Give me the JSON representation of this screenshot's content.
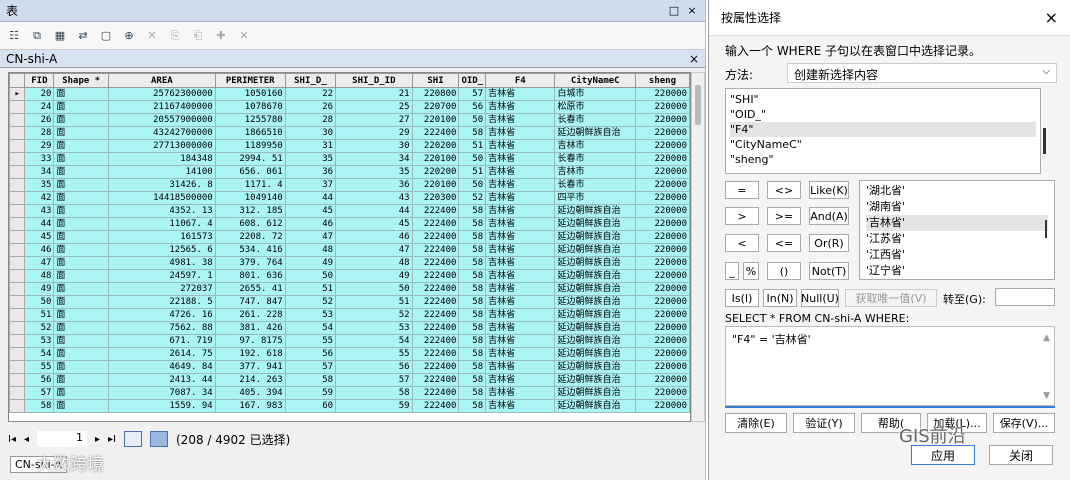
{
  "table_window": {
    "title": "表",
    "title_controls": [
      "□",
      "×"
    ],
    "toolbar_icons": [
      "table-options-icon",
      "related-tables-icon",
      "select-by-attributes-icon",
      "switch-selection-icon",
      "clear-selection-icon",
      "zoom-to-selected-icon",
      "delete-selected-icon",
      "copy-icon",
      "paste-icon",
      "add-field-icon",
      "close-toolbar-icon"
    ],
    "tab_name": "CN-shi-A",
    "tab_close": "×",
    "columns": [
      "FID",
      "Shape *",
      "AREA",
      "PERIMETER",
      "SHI_D_",
      "SHI_D_ID",
      "SHI",
      "OID_",
      "F4",
      "CityNameC",
      "sheng"
    ],
    "rows": [
      [
        "20",
        "面",
        "25762300000",
        "1050160",
        "22",
        "21",
        "220800",
        "57",
        "吉林省",
        "白城市",
        "220000"
      ],
      [
        "24",
        "面",
        "21167400000",
        "1078670",
        "26",
        "25",
        "220700",
        "56",
        "吉林省",
        "松原市",
        "220000"
      ],
      [
        "26",
        "面",
        "20557900000",
        "1255780",
        "28",
        "27",
        "220100",
        "50",
        "吉林省",
        "长春市",
        "220000"
      ],
      [
        "28",
        "面",
        "43242700000",
        "1866510",
        "30",
        "29",
        "222400",
        "58",
        "吉林省",
        "延边朝鲜族自治",
        "220000"
      ],
      [
        "29",
        "面",
        "27713000000",
        "1189950",
        "31",
        "30",
        "220200",
        "51",
        "吉林省",
        "吉林市",
        "220000"
      ],
      [
        "33",
        "面",
        "184348",
        "2994. 51",
        "35",
        "34",
        "220100",
        "50",
        "吉林省",
        "长春市",
        "220000"
      ],
      [
        "34",
        "面",
        "14100",
        "656. 061",
        "36",
        "35",
        "220200",
        "51",
        "吉林省",
        "吉林市",
        "220000"
      ],
      [
        "35",
        "面",
        "31426. 8",
        "1171. 4",
        "37",
        "36",
        "220100",
        "50",
        "吉林省",
        "长春市",
        "220000"
      ],
      [
        "42",
        "面",
        "14418500000",
        "1049140",
        "44",
        "43",
        "220300",
        "52",
        "吉林省",
        "四平市",
        "220000"
      ],
      [
        "43",
        "面",
        "4352. 13",
        "312. 185",
        "45",
        "44",
        "222400",
        "58",
        "吉林省",
        "延边朝鲜族自治",
        "220000"
      ],
      [
        "44",
        "面",
        "11067. 4",
        "608. 612",
        "46",
        "45",
        "222400",
        "58",
        "吉林省",
        "延边朝鲜族自治",
        "220000"
      ],
      [
        "45",
        "面",
        "161573",
        "2208. 72",
        "47",
        "46",
        "222400",
        "58",
        "吉林省",
        "延边朝鲜族自治",
        "220000"
      ],
      [
        "46",
        "面",
        "12565. 6",
        "534. 416",
        "48",
        "47",
        "222400",
        "58",
        "吉林省",
        "延边朝鲜族自治",
        "220000"
      ],
      [
        "47",
        "面",
        "4981. 38",
        "379. 764",
        "49",
        "48",
        "222400",
        "58",
        "吉林省",
        "延边朝鲜族自治",
        "220000"
      ],
      [
        "48",
        "面",
        "24597. 1",
        "801. 636",
        "50",
        "49",
        "222400",
        "58",
        "吉林省",
        "延边朝鲜族自治",
        "220000"
      ],
      [
        "49",
        "面",
        "272037",
        "2655. 41",
        "51",
        "50",
        "222400",
        "58",
        "吉林省",
        "延边朝鲜族自治",
        "220000"
      ],
      [
        "50",
        "面",
        "22188. 5",
        "747. 847",
        "52",
        "51",
        "222400",
        "58",
        "吉林省",
        "延边朝鲜族自治",
        "220000"
      ],
      [
        "51",
        "面",
        "4726. 16",
        "261. 228",
        "53",
        "52",
        "222400",
        "58",
        "吉林省",
        "延边朝鲜族自治",
        "220000"
      ],
      [
        "52",
        "面",
        "7562. 88",
        "381. 426",
        "54",
        "53",
        "222400",
        "58",
        "吉林省",
        "延边朝鲜族自治",
        "220000"
      ],
      [
        "53",
        "面",
        "671. 719",
        "97. 8175",
        "55",
        "54",
        "222400",
        "58",
        "吉林省",
        "延边朝鲜族自治",
        "220000"
      ],
      [
        "54",
        "面",
        "2614. 75",
        "192. 618",
        "56",
        "55",
        "222400",
        "58",
        "吉林省",
        "延边朝鲜族自治",
        "220000"
      ],
      [
        "55",
        "面",
        "4649. 84",
        "377. 941",
        "57",
        "56",
        "222400",
        "58",
        "吉林省",
        "延边朝鲜族自治",
        "220000"
      ],
      [
        "56",
        "面",
        "2413. 44",
        "214. 263",
        "58",
        "57",
        "222400",
        "58",
        "吉林省",
        "延边朝鲜族自治",
        "220000"
      ],
      [
        "57",
        "面",
        "7087. 34",
        "405. 394",
        "59",
        "58",
        "222400",
        "58",
        "吉林省",
        "延边朝鲜族自治",
        "220000"
      ],
      [
        "58",
        "面",
        "1559. 94",
        "167. 983",
        "60",
        "59",
        "222400",
        "58",
        "吉林省",
        "延边朝鲜族自治",
        "220000"
      ]
    ],
    "current_row_marker": "▸",
    "status": {
      "nav_first": "I◂",
      "nav_prev": "◂",
      "page": "1",
      "nav_next": "▸",
      "nav_last": "▸I",
      "selection_text": "(208 / 4902 已选择)"
    },
    "bottom_tab": "CN-shi-A",
    "watermark": "大数跨境"
  },
  "dialog": {
    "title": "按属性选择",
    "close": "×",
    "instruction": "输入一个 WHERE 子句以在表窗口中选择记录。",
    "method_label": "方法:",
    "method_value": "创建新选择内容",
    "fields": [
      "\"SHI\"",
      "\"OID_\"",
      "\"F4\"",
      "\"CityNameC\"",
      "\"sheng\""
    ],
    "selected_field": "\"F4\"",
    "operators": [
      "=",
      "<>",
      "Like(K)",
      ">",
      ">=",
      "And(A)",
      "<",
      "<=",
      "Or(R)",
      "_",
      "%",
      "()",
      "Not(T)"
    ],
    "values": [
      "'湖北省'",
      "'湖南省'",
      "'吉林省'",
      "'江苏省'",
      "'江西省'",
      "'辽宁省'"
    ],
    "selected_value": "'吉林省'",
    "is_btn": "Is(I)",
    "in_btn": "In(N)",
    "null_btn": "Null(U)",
    "unique_btn": "获取唯一值(V)",
    "goto_label": "转至(G):",
    "select_from": "SELECT * FROM CN-shi-A WHERE:",
    "where_clause": "\"F4\" = '吉林省'",
    "clear_btn": "清除(E)",
    "verify_btn": "验证(Y)",
    "help_btn": "帮助(",
    "load_btn": "加载(L)...",
    "save_btn": "保存(V)...",
    "ok_btn": "应用",
    "close_btn": "关闭",
    "brand": "GIS前沿",
    "accent_color": "#3a7bd5"
  }
}
